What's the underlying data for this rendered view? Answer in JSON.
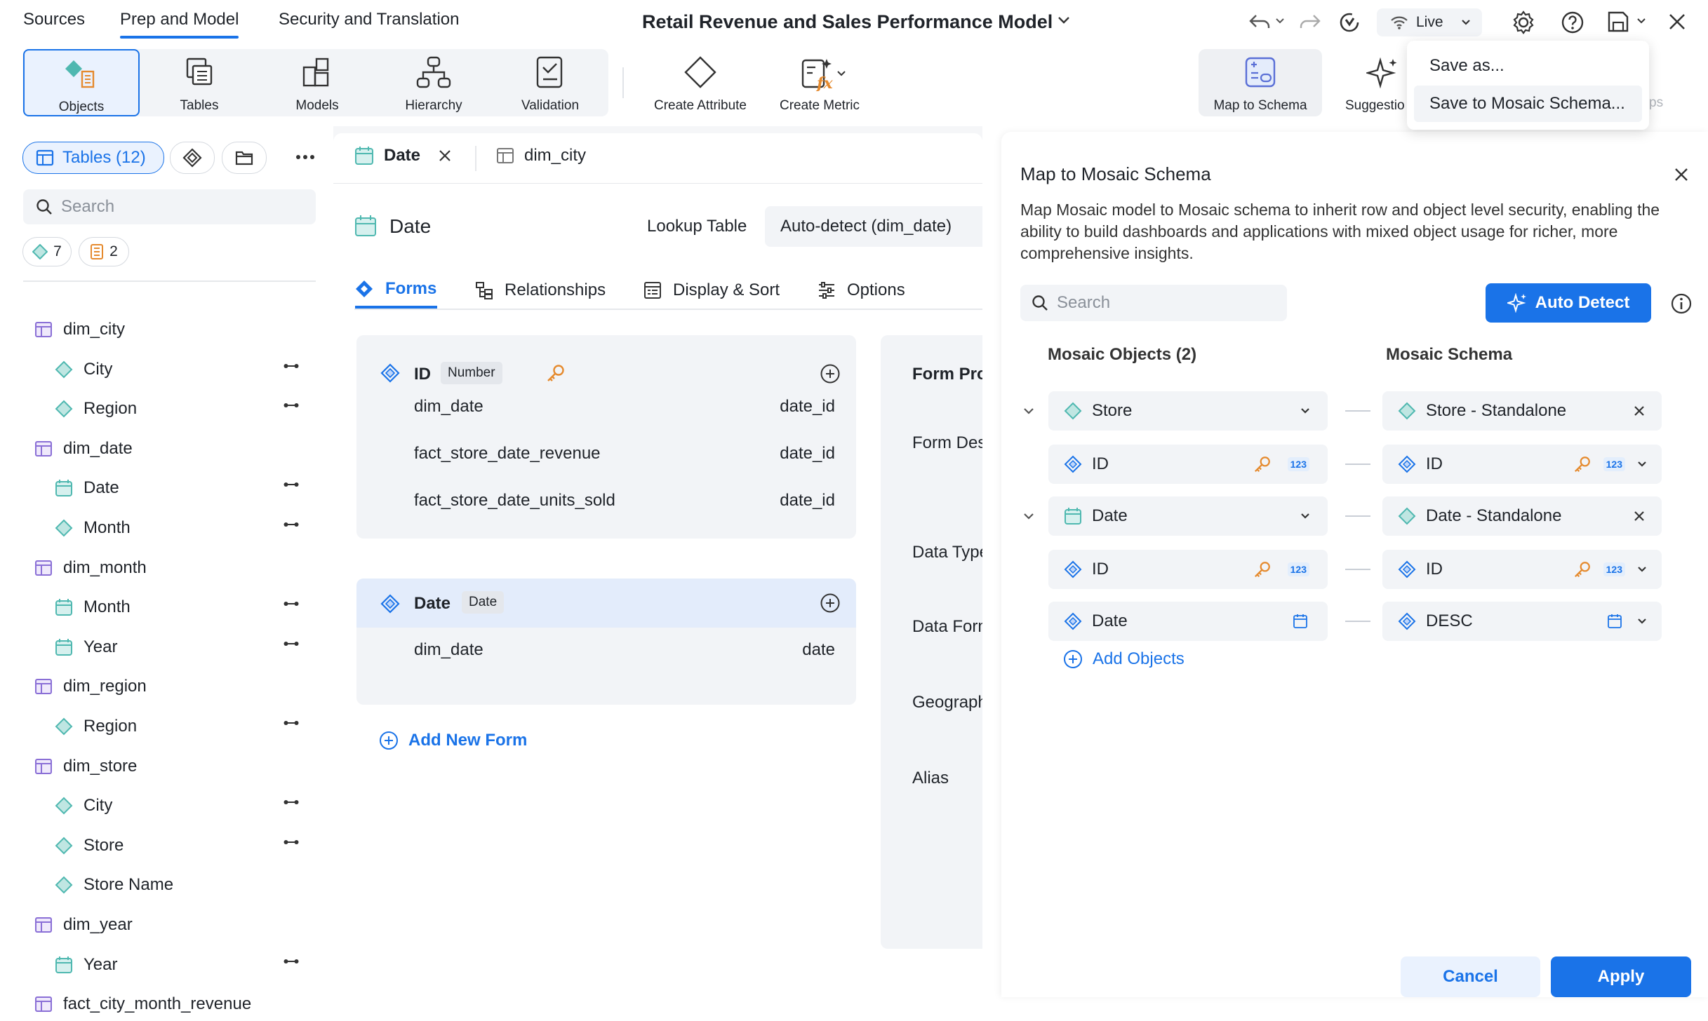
{
  "nav": {
    "tabs": [
      "Sources",
      "Prep and Model",
      "Security and Translation"
    ],
    "active_tab": "Prep and Model",
    "title": "Retail Revenue and Sales Performance Model",
    "live_label": "Live"
  },
  "ribbon": {
    "objects": "Objects",
    "tables": "Tables",
    "models": "Models",
    "hierarchy": "Hierarchy",
    "validation": "Validation",
    "create_attribute": "Create Attribute",
    "create_metric": "Create Metric",
    "map_to_schema": "Map to Schema",
    "suggestions": "Suggestio",
    "ps": "ps"
  },
  "save_menu": {
    "items": [
      "Save as...",
      "Save to Mosaic Schema..."
    ]
  },
  "left": {
    "tables_pill": "Tables (12)",
    "search_placeholder": "Search",
    "attr_count": "7",
    "metric_count": "2",
    "tree": [
      {
        "label": "dim_city",
        "type": "table"
      },
      {
        "label": "City",
        "type": "attribute"
      },
      {
        "label": "Region",
        "type": "attribute"
      },
      {
        "label": "dim_date",
        "type": "table"
      },
      {
        "label": "Date",
        "type": "date"
      },
      {
        "label": "Month",
        "type": "attribute"
      },
      {
        "label": "dim_month",
        "type": "table"
      },
      {
        "label": "Month",
        "type": "date"
      },
      {
        "label": "Year",
        "type": "date"
      },
      {
        "label": "dim_region",
        "type": "table"
      },
      {
        "label": "Region",
        "type": "attribute"
      },
      {
        "label": "dim_store",
        "type": "table"
      },
      {
        "label": "City",
        "type": "attribute"
      },
      {
        "label": "Store",
        "type": "attribute"
      },
      {
        "label": "Store Name",
        "type": "attribute-nolink"
      },
      {
        "label": "dim_year",
        "type": "table"
      },
      {
        "label": "Year",
        "type": "date"
      },
      {
        "label": "fact_city_month_revenue",
        "type": "table"
      }
    ]
  },
  "center": {
    "tabs": [
      "Date",
      "dim_city"
    ],
    "header_title": "Date",
    "lookup_label": "Lookup Table",
    "lookup_value": "Auto-detect (dim_date)",
    "subtabs": [
      "Forms",
      "Relationships",
      "Display & Sort",
      "Options"
    ],
    "form_id": {
      "name": "ID",
      "badge": "Number",
      "rows": [
        {
          "table": "dim_date",
          "col": "date_id"
        },
        {
          "table": "fact_store_date_revenue",
          "col": "date_id"
        },
        {
          "table": "fact_store_date_units_sold",
          "col": "date_id"
        }
      ]
    },
    "form_date": {
      "name": "Date",
      "badge": "Date",
      "rows": [
        {
          "table": "dim_date",
          "col": "date"
        }
      ]
    },
    "add_form": "Add New Form",
    "props": [
      "Form Prop",
      "Form Des",
      "Data Type",
      "Data Form",
      "Geograph",
      "Alias"
    ]
  },
  "dialog": {
    "title": "Map to Mosaic Schema",
    "description": "Map Mosaic model to Mosaic schema to inherit row and object level security, enabling the ability to build dashboards and applications with mixed object usage for richer, more comprehensive insights.",
    "search_placeholder": "Search",
    "auto_detect": "Auto Detect",
    "col_objects": "Mosaic Objects (2)",
    "col_schema": "Mosaic Schema",
    "mappings": [
      {
        "left": "Store",
        "right": "Store - Standalone",
        "group": true
      },
      {
        "left": "ID",
        "right": "ID",
        "group": false
      },
      {
        "left": "Date",
        "right": "Date - Standalone",
        "group": true
      },
      {
        "left": "ID",
        "right": "ID",
        "group": false
      },
      {
        "left": "Date",
        "right": "DESC",
        "group": false
      }
    ],
    "num_badge": "123",
    "add_objects": "Add Objects",
    "cancel": "Cancel",
    "apply": "Apply"
  },
  "colors": {
    "accent": "#1a73e8",
    "attribute": "#4fb8b0",
    "table": "#8a6fd6",
    "key": "#e58a2e"
  }
}
